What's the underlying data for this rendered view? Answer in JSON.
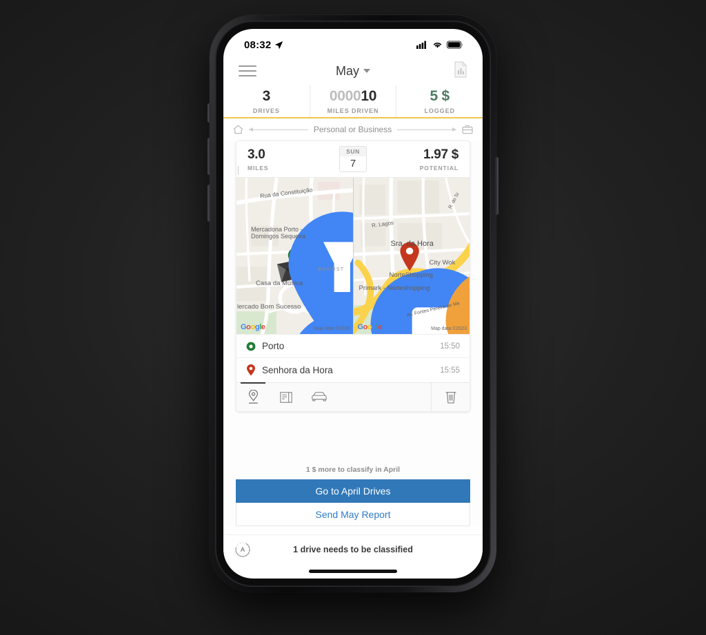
{
  "status_bar": {
    "time": "08:32",
    "location_icon": "location-arrow-icon",
    "signal_icon": "cellular-signal-icon",
    "wifi_icon": "wifi-icon",
    "battery_icon": "battery-full-icon"
  },
  "nav": {
    "menu_icon": "hamburger-menu-icon",
    "month": "May",
    "report_icon": "report-document-icon"
  },
  "stats": [
    {
      "key": "drives",
      "value": "3",
      "label": "DRIVES"
    },
    {
      "key": "miles",
      "value_zeros": "0000",
      "value": "10",
      "label": "MILES DRIVEN"
    },
    {
      "key": "logged",
      "value": "5 $",
      "label": "LOGGED",
      "color": "#4d7a5f"
    }
  ],
  "classify_hint": {
    "left_icon": "home-icon",
    "label": "Personal or Business",
    "right_icon": "briefcase-icon"
  },
  "drive_card": {
    "miles_value": "3.0",
    "miles_label": "MILES",
    "date_dow": "SUN",
    "date_dom": "7",
    "potential_value": "1.97 $",
    "potential_label": "POTENTIAL",
    "maps": {
      "left": {
        "labels": [
          "Rua da Constituição",
          "Mercadona Porto -",
          "Domingos Sequeira",
          "Casa da Música",
          "BOAVIST",
          "lercado Bom Sucesso"
        ],
        "watermark": "Google",
        "attribution": "Map data ©2023",
        "marker": "start-marker-green"
      },
      "right": {
        "labels": [
          "R. Lagos",
          "R. do Sr",
          "Sra. da Hora",
          "City Wok",
          "NorteShopping",
          "Primark - Norteshopping",
          "Av. Fontes Pereira de Me"
        ],
        "watermark": "Google",
        "attribution": "Map data ©2023",
        "marker": "end-marker-red"
      }
    },
    "stops": [
      {
        "icon": "start-dot-icon",
        "name": "Porto",
        "time": "15:50"
      },
      {
        "icon": "end-pin-icon",
        "name": "Senhora da Hora",
        "time": "15:55"
      }
    ],
    "toolbar": [
      {
        "icon": "map-pin-icon",
        "name": "route-tab",
        "active": true
      },
      {
        "icon": "notes-icon",
        "name": "notes-tab",
        "active": false
      },
      {
        "icon": "car-icon",
        "name": "vehicle-tab",
        "active": false
      }
    ],
    "delete_icon": "trash-icon"
  },
  "footer": {
    "note": "1 $ more to classify in April",
    "primary_label": "Go to April Drives",
    "secondary_label": "Send May Report"
  },
  "bottom_bar": {
    "badge_letter": "A",
    "badge_name": "auto-classify-progress",
    "status": "1 drive needs to be classified"
  },
  "colors": {
    "accent_yellow": "#f0c64a",
    "primary_blue": "#3178b8",
    "link_blue": "#2f7cc4",
    "green": "#4d7a5f",
    "start_marker": "#1e7b34",
    "end_marker": "#c5371d"
  }
}
